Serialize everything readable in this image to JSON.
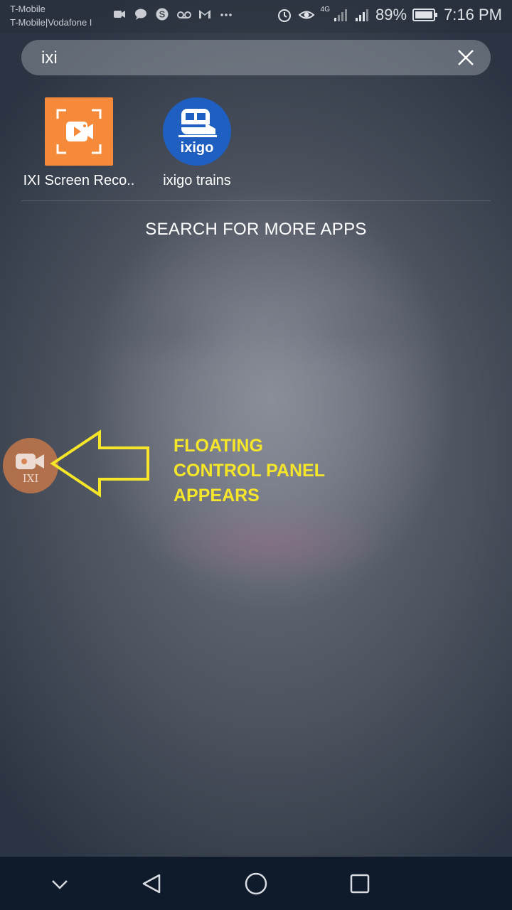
{
  "status_bar": {
    "carrier_line1": "T-Mobile",
    "carrier_line2": "T-Mobile|Vodafone I",
    "battery": "89%",
    "time": "7:16 PM",
    "network_label": "4G",
    "notification_icons": [
      "screen-recorder-icon",
      "chat-bubble-icon",
      "skype-icon",
      "voicemail-icon",
      "gmail-icon",
      "more-dots-icon"
    ],
    "status_icons": [
      "alarm-icon",
      "eye-icon",
      "signal-icon",
      "battery-icon"
    ]
  },
  "search": {
    "query": "ixi",
    "clear_icon": "close-icon"
  },
  "apps": [
    {
      "label": "IXI Screen Reco..",
      "icon": "screen-recorder-app-icon",
      "color": "#f58a3a"
    },
    {
      "label": "ixigo trains",
      "icon": "ixigo-trains-app-icon",
      "color": "#1f5fc2",
      "icon_text": "ixigo"
    }
  ],
  "more_apps_label": "SEARCH FOR MORE APPS",
  "floating_button": {
    "icon": "camera-icon",
    "text": "IXI"
  },
  "annotation": {
    "line1": "FLOATING",
    "line2": "CONTROL PANEL",
    "line3": "APPEARS",
    "color": "#f5e62a"
  },
  "navbar": {
    "buttons": [
      "collapse-icon",
      "back-icon",
      "home-icon",
      "recents-icon"
    ]
  }
}
